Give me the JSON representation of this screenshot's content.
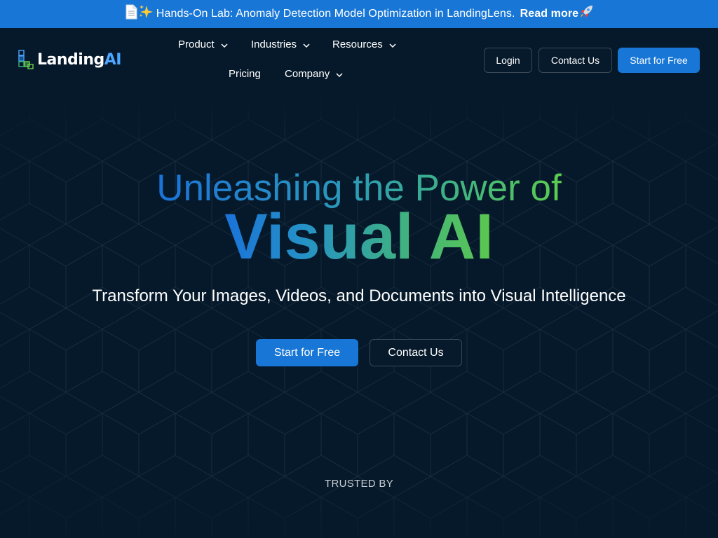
{
  "announcement": {
    "doc_icon": "document-emoji",
    "sparkle_icon": "sparkles-emoji",
    "text": "Hands-On Lab: Anomaly Detection Model Optimization in LandingLens.",
    "link_label": "Read more",
    "rocket_icon": "rocket-emoji",
    "background_color": "#1877d6"
  },
  "header": {
    "logo": {
      "text_main": "Landing",
      "text_accent": "AI"
    },
    "nav": [
      {
        "label": "Product",
        "has_dropdown": true
      },
      {
        "label": "Industries",
        "has_dropdown": true
      },
      {
        "label": "Resources",
        "has_dropdown": true
      },
      {
        "label": "Pricing",
        "has_dropdown": false
      },
      {
        "label": "Company",
        "has_dropdown": true
      }
    ],
    "login_label": "Login",
    "contact_label": "Contact Us",
    "start_label": "Start for Free"
  },
  "hero": {
    "headline_line1": "Unleashing the Power of",
    "headline_line2": "Visual AI",
    "subheadline": "Transform Your Images, Videos, and Documents into Visual Intelligence",
    "primary_cta": "Start for Free",
    "secondary_cta": "Contact Us",
    "trusted_by": "TRUSTED BY"
  },
  "colors": {
    "page_bg": "#06192a",
    "primary": "#1877d6",
    "gradient_start": "#1a73d9",
    "gradient_end": "#5ccc50"
  }
}
